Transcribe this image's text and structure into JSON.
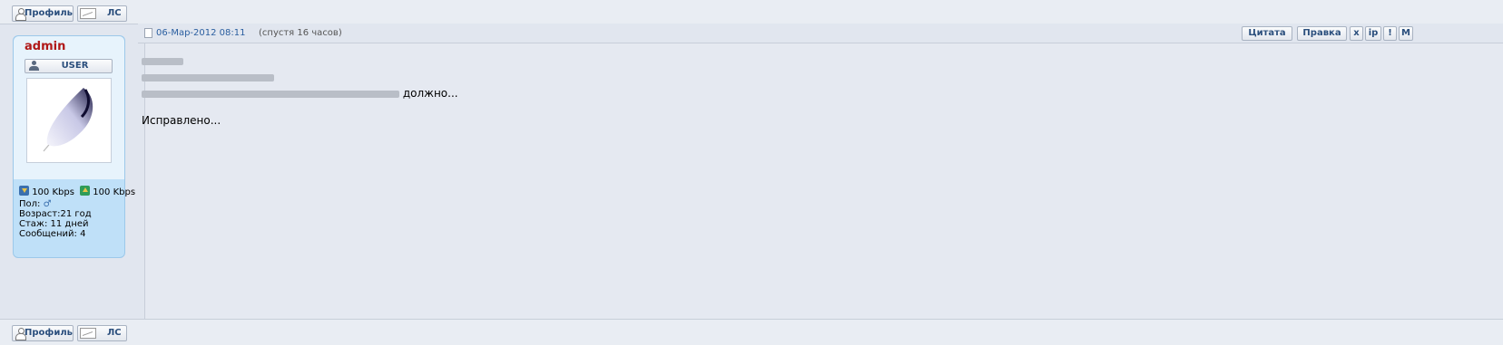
{
  "top_bar": {
    "profile_label": "Профиль",
    "pm_label": "ЛС"
  },
  "bottom_bar": {
    "profile_label": "Профиль",
    "pm_label": "ЛС"
  },
  "user_card": {
    "username": "admin",
    "rank": "USER",
    "avatar_icon": "feather-icon",
    "download_speed": "100 Kbps",
    "upload_speed": "100 Kbps",
    "gender_label": "Пол:",
    "gender_symbol": "♂",
    "age_label": "Возраст:",
    "age_value": "21 год",
    "tenure_label": "Стаж:",
    "tenure_value": "11 дней",
    "posts_label": "Сообщений:",
    "posts_value": "4"
  },
  "post": {
    "date": "06-Мар-2012 08:11",
    "relative_time": "(спустя 16 часов)",
    "tools": {
      "quote": "Цитата",
      "edit": "Правка",
      "delete": "x",
      "ip": "ip",
      "report": "!",
      "moderate": "M"
    },
    "visible_line_end": "должно...",
    "body_text": "Исправлено..."
  },
  "colors": {
    "username": "#b01818",
    "link": "#2b5fa0",
    "card_bg": "#bfe0f8",
    "page_bg": "#e5e9f1"
  }
}
